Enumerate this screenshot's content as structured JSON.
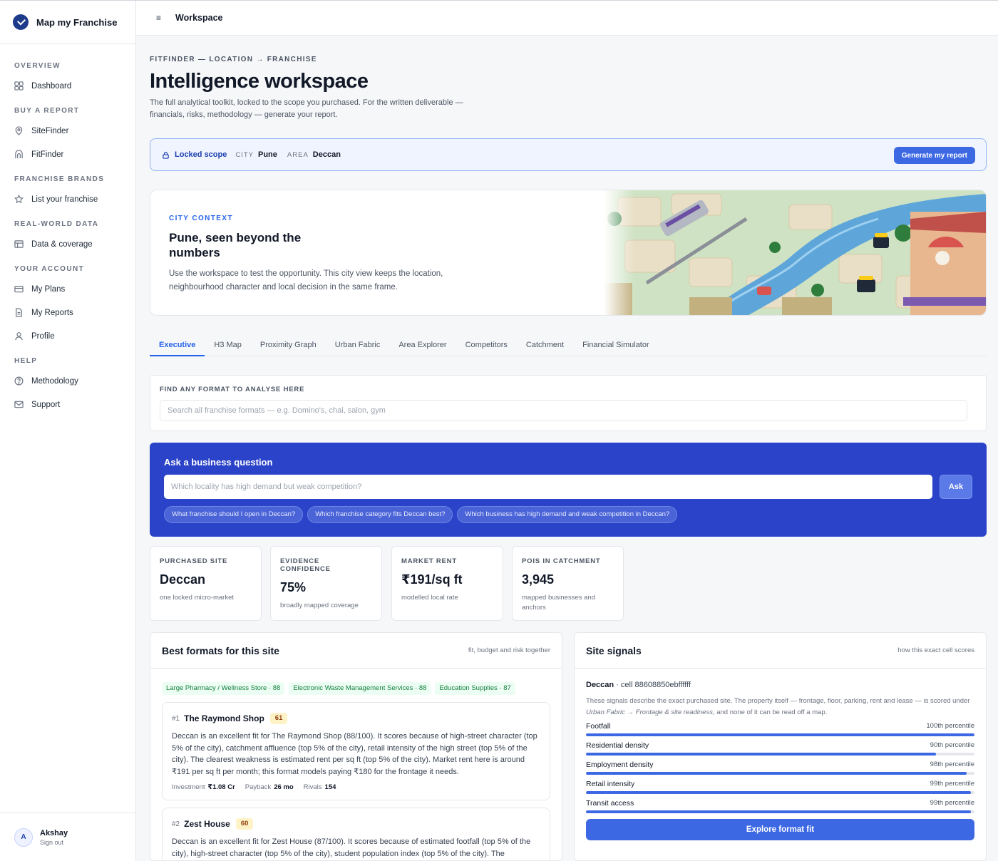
{
  "app": {
    "name": "Map my Franchise",
    "topbar_title": "Workspace",
    "menu_glyph": "≡"
  },
  "sidebar": {
    "sections": [
      {
        "label": "OVERVIEW",
        "items": [
          {
            "label": "Dashboard",
            "icon": "grid-icon"
          }
        ]
      },
      {
        "label": "BUY A REPORT",
        "items": [
          {
            "label": "SiteFinder",
            "icon": "map-pin-icon"
          },
          {
            "label": "FitFinder",
            "icon": "storefront-icon"
          }
        ]
      },
      {
        "label": "FRANCHISE BRANDS",
        "items": [
          {
            "label": "List your franchise",
            "icon": "star-icon"
          }
        ]
      },
      {
        "label": "REAL-WORLD DATA",
        "items": [
          {
            "label": "Data & coverage",
            "icon": "table-icon"
          }
        ]
      },
      {
        "label": "YOUR ACCOUNT",
        "items": [
          {
            "label": "My Plans",
            "icon": "credit-card-icon"
          },
          {
            "label": "My Reports",
            "icon": "document-icon"
          },
          {
            "label": "Profile",
            "icon": "user-icon"
          }
        ]
      },
      {
        "label": "HELP",
        "items": [
          {
            "label": "Methodology",
            "icon": "help-circle-icon"
          },
          {
            "label": "Support",
            "icon": "mail-icon"
          }
        ]
      }
    ],
    "user": {
      "initial": "A",
      "name": "Akshay",
      "action": "Sign out"
    }
  },
  "header": {
    "eyebrow": "FITFINDER — LOCATION → FRANCHISE",
    "title": "Intelligence workspace",
    "description": "The full analytical toolkit, locked to the scope you purchased. For the written deliverable — financials, risks, methodology — generate your report."
  },
  "scope": {
    "label": "Locked scope",
    "city_key": "CITY",
    "city": "Pune",
    "area_key": "AREA",
    "area": "Deccan",
    "button": "Generate my report"
  },
  "city_context": {
    "eyebrow": "CITY CONTEXT",
    "title": "Pune, seen beyond the numbers",
    "description": "Use the workspace to test the opportunity. This city view keeps the location, neighbourhood character and local decision in the same frame."
  },
  "tabs": [
    {
      "label": "Executive",
      "active": true
    },
    {
      "label": "H3 Map"
    },
    {
      "label": "Proximity Graph"
    },
    {
      "label": "Urban Fabric"
    },
    {
      "label": "Area Explorer"
    },
    {
      "label": "Competitors"
    },
    {
      "label": "Catchment"
    },
    {
      "label": "Financial Simulator"
    }
  ],
  "format_search": {
    "label": "FIND ANY FORMAT TO ANALYSE HERE",
    "placeholder": "Search all franchise formats — e.g. Domino's, chai, salon, gym"
  },
  "ask": {
    "title": "Ask a business question",
    "placeholder": "Which locality has high demand but weak competition?",
    "button": "Ask",
    "suggestions": [
      "What franchise should I open in Deccan?",
      "Which franchise category fits Deccan best?",
      "Which business has high demand and weak competition in Deccan?"
    ]
  },
  "stats": [
    {
      "label": "PURCHASED SITE",
      "value": "Deccan",
      "sub": "one locked micro-market"
    },
    {
      "label": "EVIDENCE CONFIDENCE",
      "value": "75%",
      "sub": "broadly mapped coverage"
    },
    {
      "label": "MARKET RENT",
      "value": "₹191/sq ft",
      "sub": "modelled local rate"
    },
    {
      "label": "POIS IN CATCHMENT",
      "value": "3,945",
      "sub": "mapped businesses and anchors"
    }
  ],
  "best_formats": {
    "title": "Best formats for this site",
    "hint": "fit, budget and risk together",
    "tags": [
      "Large Pharmacy / Wellness Store · 88",
      "Electronic Waste Management Services · 88",
      "Education Supplies · 87"
    ],
    "items": [
      {
        "rank": "#1",
        "name": "The Raymond Shop",
        "score": "61",
        "text": "Deccan is an excellent fit for The Raymond Shop (88/100). It scores because of high-street character (top 5% of the city), catchment affluence (top 5% of the city), retail intensity of the high street (top 5% of the city). The clearest weakness is estimated rent per sq ft (top 5% of the city). Market rent here is around ₹191 per sq ft per month; this format models paying ₹180 for the frontage it needs.",
        "investment_label": "Investment",
        "investment": "₹1.08 Cr",
        "payback_label": "Payback",
        "payback": "26 mo",
        "rivals_label": "Rivals",
        "rivals": "154"
      },
      {
        "rank": "#2",
        "name": "Zest House",
        "score": "60",
        "text": "Deccan is an excellent fit for Zest House (87/100). It scores because of estimated footfall (top 5% of the city), high-street character (top 5% of the city), student population index (top 5% of the city). The"
      }
    ]
  },
  "site_signals": {
    "title": "Site signals",
    "hint": "how this exact cell scores",
    "cell_area": "Deccan",
    "cell_id": "· cell 88608850ebffffff",
    "desc_a": "These signals describe the exact purchased site. The property itself — frontage, floor, parking, rent and lease — is scored under ",
    "desc_em": "Urban Fabric → Frontage & site readiness",
    "desc_b": ", and none of it can be read off a map.",
    "signals": [
      {
        "label": "Footfall",
        "percentile": "100th percentile",
        "value": 1.0
      },
      {
        "label": "Residential density",
        "percentile": "90th percentile",
        "value": 0.9
      },
      {
        "label": "Employment density",
        "percentile": "98th percentile",
        "value": 0.98
      },
      {
        "label": "Retail intensity",
        "percentile": "99th percentile",
        "value": 0.99
      },
      {
        "label": "Transit access",
        "percentile": "99th percentile",
        "value": 0.99
      }
    ],
    "button": "Explore format fit"
  }
}
